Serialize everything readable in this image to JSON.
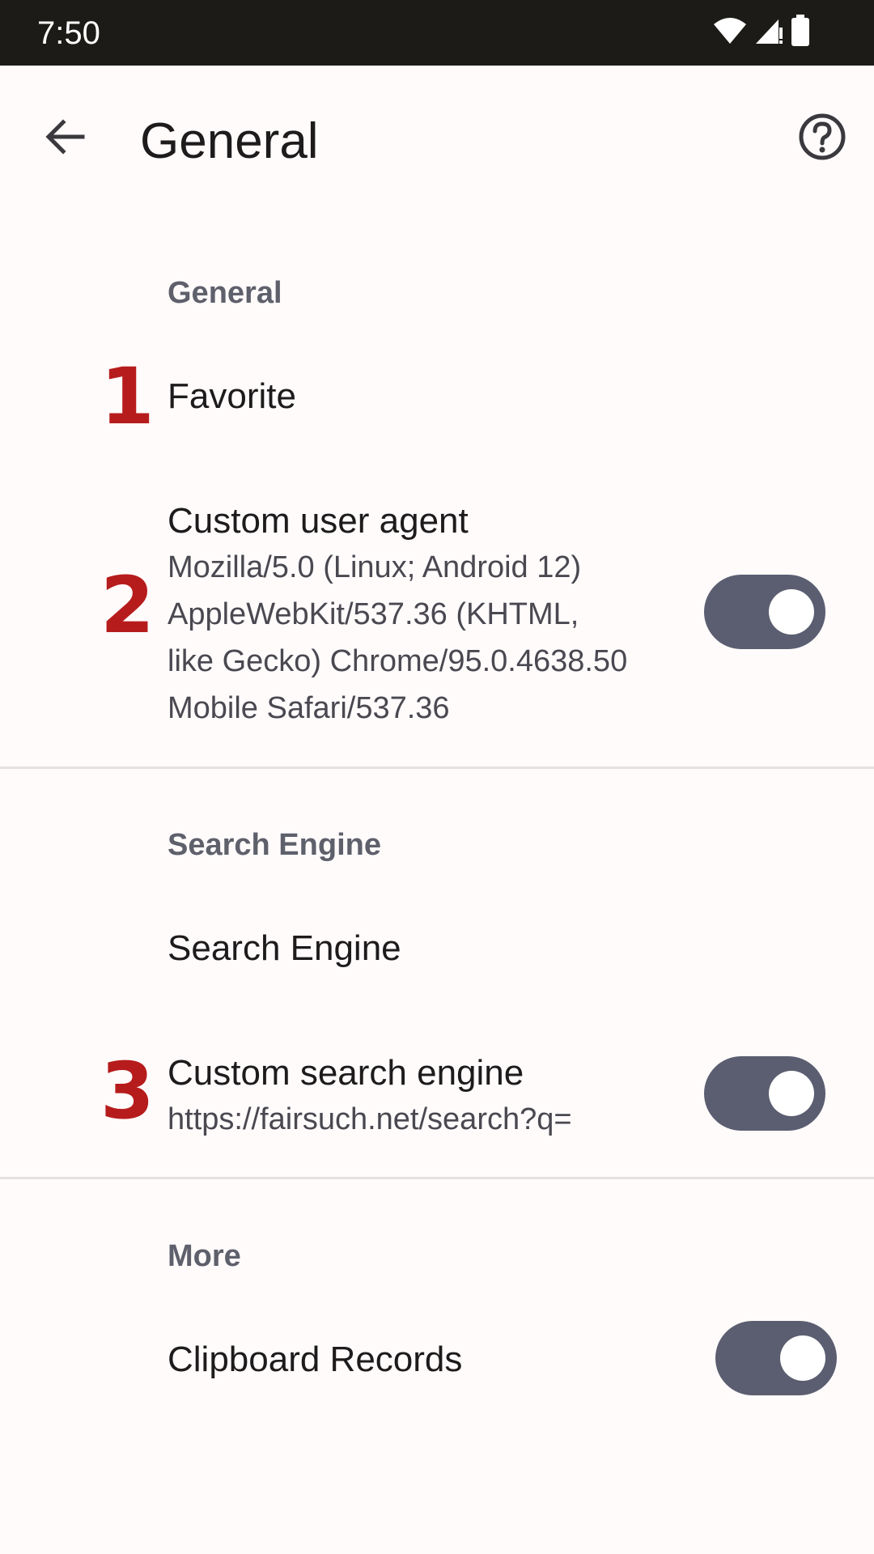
{
  "status_bar": {
    "time": "7:50",
    "icons": [
      "wifi-icon",
      "signal-icon",
      "battery-icon"
    ]
  },
  "app_bar": {
    "title": "General",
    "back_icon": "arrow-back-icon",
    "help_icon": "help-circle-icon"
  },
  "sections": {
    "general": {
      "header": "General",
      "favorite": {
        "marker": "1",
        "title": "Favorite"
      },
      "user_agent": {
        "marker": "2",
        "title": "Custom user agent",
        "summary_lines": [
          "Mozilla/5.0 (Linux; Android 12)",
          "AppleWebKit/537.36 (KHTML,",
          "like Gecko) Chrome/95.0.4638.50",
          "Mobile Safari/537.36"
        ],
        "enabled": true
      }
    },
    "search": {
      "header": "Search Engine",
      "engine": {
        "title": "Search Engine"
      },
      "custom": {
        "marker": "3",
        "title": "Custom search engine",
        "summary": "https://fairsuch.net/search?q=",
        "enabled": true
      }
    },
    "more": {
      "header": "More",
      "clipboard": {
        "title": "Clipboard Records",
        "enabled": true
      }
    }
  },
  "colors": {
    "background": "#fffbfb",
    "status_bar": "#1c1b17",
    "toggle_track": "#5b5e70",
    "marker": "#b71c1c",
    "section_header": "#5e606b"
  }
}
